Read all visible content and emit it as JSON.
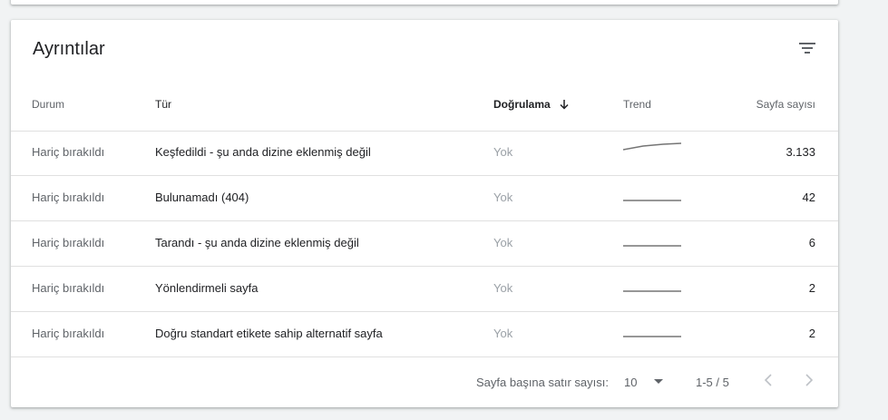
{
  "card": {
    "title": "Ayrıntılar"
  },
  "columns": {
    "status": "Durum",
    "type": "Tür",
    "verification": "Doğrulama",
    "trend": "Trend",
    "count": "Sayfa sayısı"
  },
  "rows": [
    {
      "status": "Hariç bırakıldı",
      "type": "Keşfedildi - şu anda dizine eklenmiş değil",
      "verification": "Yok",
      "count": "3.133"
    },
    {
      "status": "Hariç bırakıldı",
      "type": "Bulunamadı (404)",
      "verification": "Yok",
      "count": "42"
    },
    {
      "status": "Hariç bırakıldı",
      "type": "Tarandı - şu anda dizine eklenmiş değil",
      "verification": "Yok",
      "count": "6"
    },
    {
      "status": "Hariç bırakıldı",
      "type": "Yönlendirmeli sayfa",
      "verification": "Yok",
      "count": "2"
    },
    {
      "status": "Hariç bırakıldı",
      "type": "Doğru standart etikete sahip alternatif sayfa",
      "verification": "Yok",
      "count": "2"
    }
  ],
  "footer": {
    "rows_per_page_label": "Sayfa başına satır sayısı:",
    "rows_per_page_value": "10",
    "range": "1-5 / 5"
  },
  "icons": {
    "filter": "filter-icon",
    "sort": "arrow-down-icon",
    "dropdown": "caret-down-icon",
    "prev": "chevron-left-icon",
    "next": "chevron-right-icon"
  },
  "colors": {
    "sparkline": "#757575",
    "divider": "#e0e0e0",
    "muted_text": "#5f6368"
  }
}
